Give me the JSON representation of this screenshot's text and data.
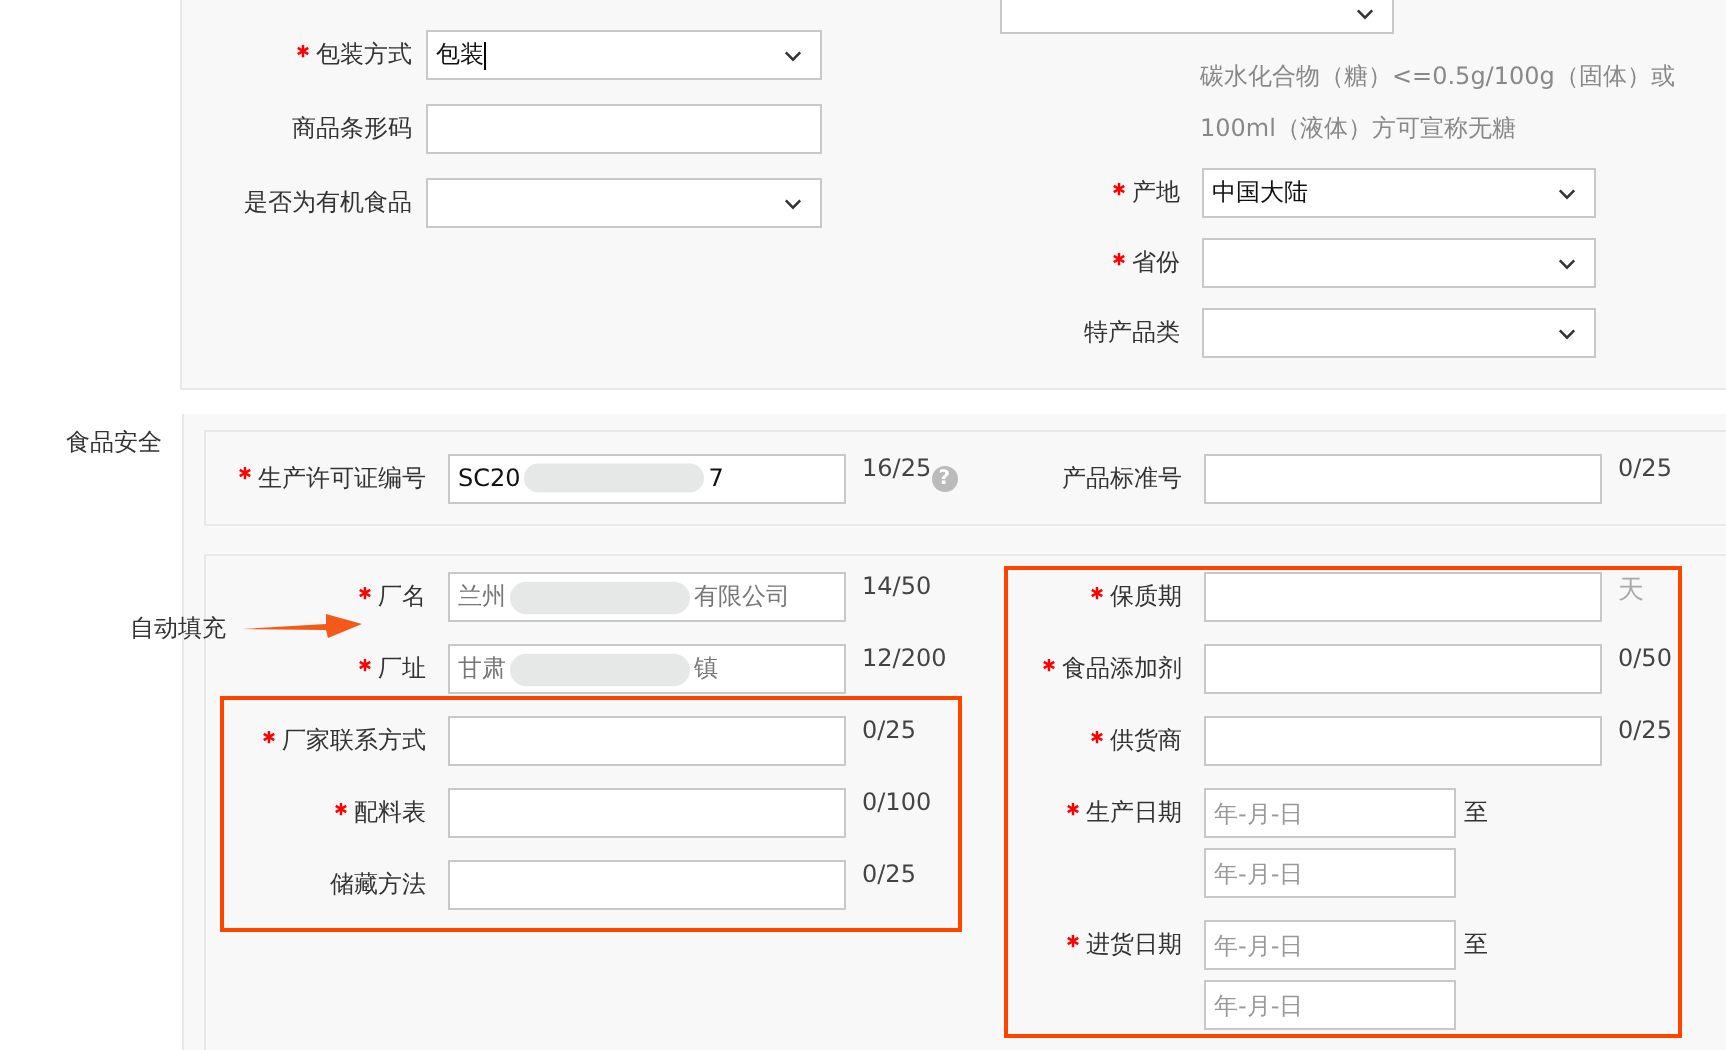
{
  "top_section": {
    "left_fields": [
      {
        "label": "包装方式",
        "required": true,
        "kind": "select",
        "value": "包装",
        "focused": true
      },
      {
        "label": "商品条形码",
        "required": false,
        "kind": "text"
      },
      {
        "label": "是否为有机食品",
        "required": false,
        "kind": "select"
      }
    ],
    "right_cut_select": {
      "kind": "select"
    },
    "right_hint": [
      "碳水化合物（糖）<=0.5g/100g（固体）或",
      "100ml（液体）方可宣称无糖"
    ],
    "right_fields": [
      {
        "label": "产地",
        "required": true,
        "kind": "select",
        "value": "中国大陆"
      },
      {
        "label": "省份",
        "required": true,
        "kind": "select"
      },
      {
        "label": "特产品类",
        "required": false,
        "kind": "select"
      }
    ]
  },
  "food_safety": {
    "title": "食品安全",
    "license_row": {
      "left": {
        "label": "生产许可证编号",
        "required": true,
        "kind": "redacted",
        "value_parts": [
          "SC20",
          "7"
        ],
        "counter": "16/25",
        "help": "?"
      },
      "right": {
        "label": "产品标准号",
        "required": false,
        "kind": "text",
        "counter": "0/25"
      }
    },
    "left_fields": [
      {
        "label": "厂名",
        "required": true,
        "kind": "redacted",
        "readonly": true,
        "value_parts": [
          "兰州",
          "有限公司"
        ],
        "counter": "14/50"
      },
      {
        "label": "厂址",
        "required": true,
        "kind": "redacted",
        "readonly": true,
        "value_parts": [
          "甘肃",
          "镇"
        ],
        "counter": "12/200"
      },
      {
        "label": "厂家联系方式",
        "required": true,
        "kind": "text",
        "counter": "0/25"
      },
      {
        "label": "配料表",
        "required": true,
        "kind": "text",
        "counter": "0/100"
      },
      {
        "label": "储藏方法",
        "required": false,
        "kind": "text",
        "counter": "0/25"
      }
    ],
    "right_fields": [
      {
        "label": "保质期",
        "required": true,
        "kind": "text",
        "suffix": "天"
      },
      {
        "label": "食品添加剂",
        "required": true,
        "kind": "text",
        "counter": "0/50"
      },
      {
        "label": "供货商",
        "required": true,
        "kind": "text",
        "counter": "0/25"
      },
      {
        "label": "生产日期",
        "required": true,
        "kind": "date_range",
        "from_placeholder": "年-月-日",
        "separator": "至",
        "to_placeholder": "年-月-日"
      },
      {
        "label": "进货日期",
        "required": true,
        "kind": "date_range",
        "from_placeholder": "年-月-日",
        "separator": "至",
        "to_placeholder": "年-月-日"
      }
    ]
  },
  "annotation": {
    "text": "自动填充"
  }
}
